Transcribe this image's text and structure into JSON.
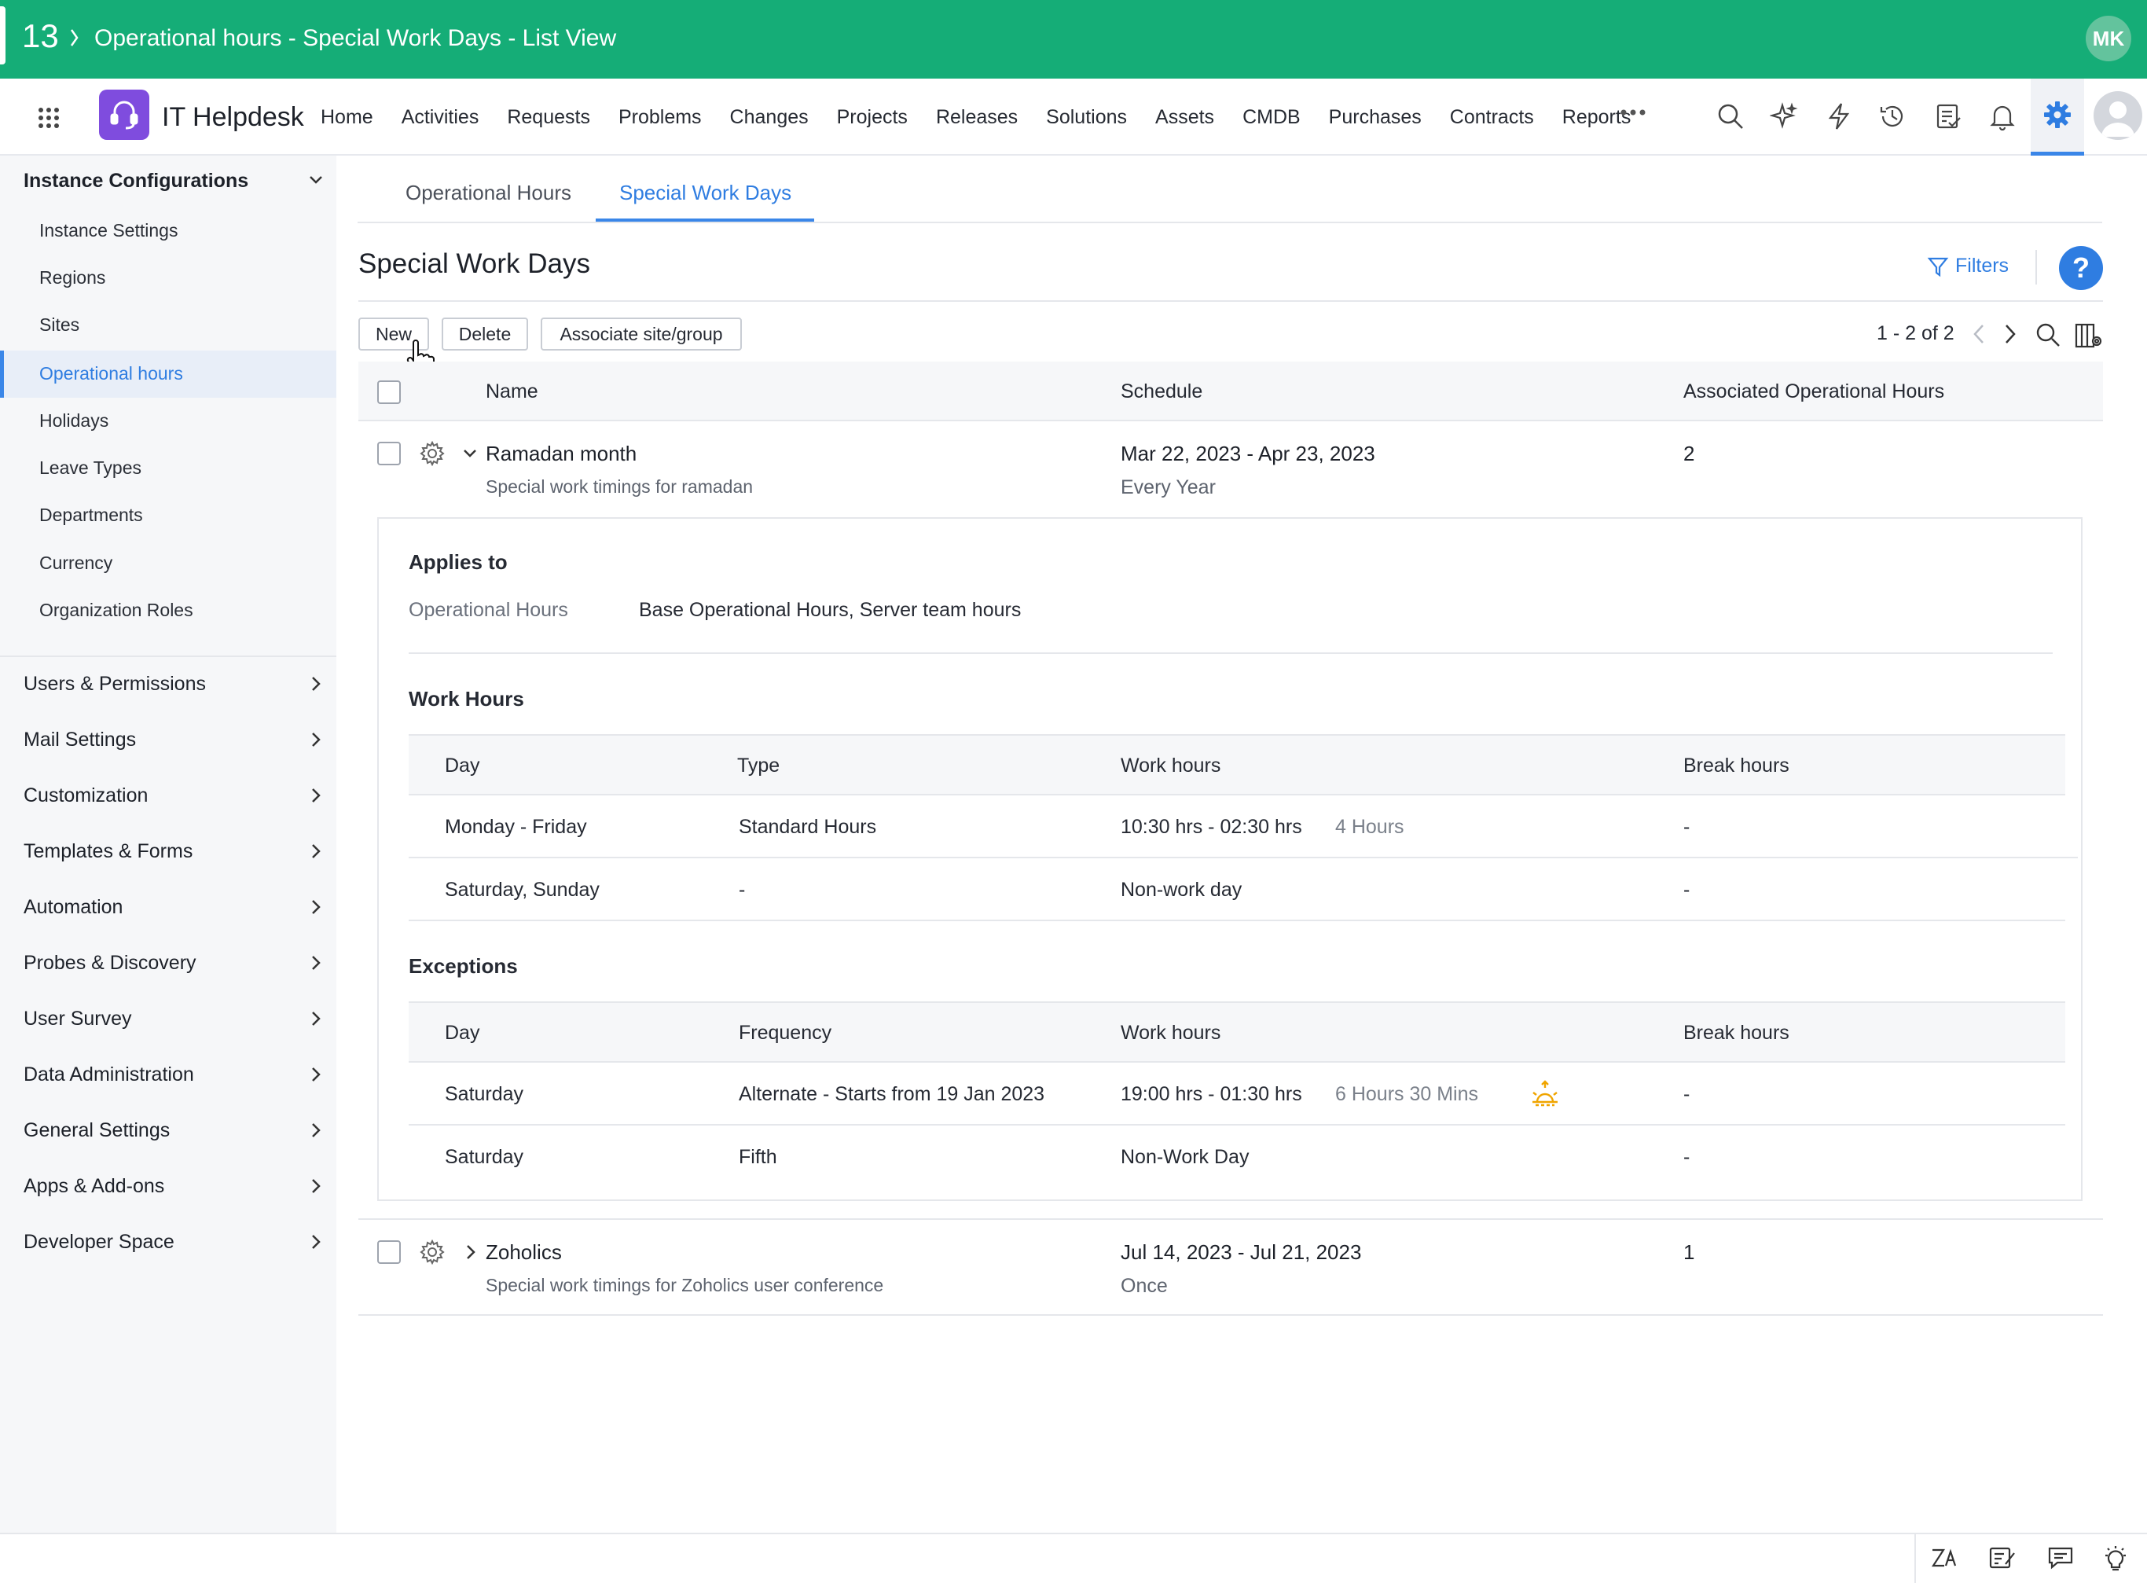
{
  "topbar": {
    "tab_number": "13",
    "title": "Operational hours - Special Work Days - List View",
    "avatar_initials": "MK"
  },
  "nav": {
    "app_name": "IT Helpdesk",
    "items": [
      "Home",
      "Activities",
      "Requests",
      "Problems",
      "Changes",
      "Projects",
      "Releases",
      "Solutions",
      "Assets",
      "CMDB",
      "Purchases",
      "Contracts",
      "Reports"
    ]
  },
  "sidebar": {
    "section_open": "Instance Configurations",
    "sub_items": [
      "Instance Settings",
      "Regions",
      "Sites",
      "Operational hours",
      "Holidays",
      "Leave Types",
      "Departments",
      "Currency",
      "Organization Roles"
    ],
    "active_item": "Operational hours",
    "sections": [
      "Users & Permissions",
      "Mail Settings",
      "Customization",
      "Templates & Forms",
      "Automation",
      "Probes & Discovery",
      "User Survey",
      "Data Administration",
      "General Settings",
      "Apps & Add-ons",
      "Developer Space"
    ]
  },
  "tabs": [
    "Operational Hours",
    "Special Work Days"
  ],
  "active_tab": "Special Work Days",
  "page": {
    "title": "Special Work Days",
    "filters_label": "Filters",
    "help_label": "?",
    "buttons": {
      "new": "New",
      "delete": "Delete",
      "associate": "Associate site/group"
    },
    "pager": "1 - 2 of 2"
  },
  "table": {
    "headers": [
      "Name",
      "Schedule",
      "Associated Operational Hours"
    ],
    "rows": [
      {
        "name": "Ramadan month",
        "description": "Special work timings for ramadan",
        "schedule": "Mar 22, 2023 - Apr 23, 2023",
        "recurrence": "Every Year",
        "associated": "2",
        "expanded": true
      },
      {
        "name": "Zoholics",
        "description": "Special work timings for Zoholics user conference",
        "schedule": "Jul 14, 2023 - Jul 21, 2023",
        "recurrence": "Once",
        "associated": "1",
        "expanded": false
      }
    ]
  },
  "details": {
    "applies_to_title": "Applies to",
    "op_hours_label": "Operational Hours",
    "op_hours_value": "Base Operational Hours, Server team hours",
    "work_hours_title": "Work Hours",
    "work_headers": [
      "Day",
      "Type",
      "Work hours",
      "Break hours"
    ],
    "work_rows": [
      {
        "day": "Monday - Friday",
        "type": "Standard Hours",
        "hours": "10:30 hrs - 02:30 hrs",
        "duration": "4 Hours",
        "break": "-"
      },
      {
        "day": "Saturday, Sunday",
        "type": "-",
        "hours": "Non-work day",
        "duration": "",
        "break": "-"
      }
    ],
    "exceptions_title": "Exceptions",
    "exc_headers": [
      "Day",
      "Frequency",
      "Work hours",
      "Break hours"
    ],
    "exc_rows": [
      {
        "day": "Saturday",
        "frequency": "Alternate - Starts from 19 Jan 2023",
        "hours": "19:00 hrs - 01:30 hrs",
        "duration": "6 Hours 30 Mins",
        "icon": "sunrise-icon",
        "break": "-"
      },
      {
        "day": "Saturday",
        "frequency": "Fifth",
        "hours": "Non-Work Day",
        "duration": "",
        "break": "-"
      }
    ]
  },
  "colors": {
    "brand_green": "#15ad77",
    "accent_blue": "#2f7de1",
    "logo_purple": "#7f4cde",
    "warning_orange": "#f0a500"
  }
}
